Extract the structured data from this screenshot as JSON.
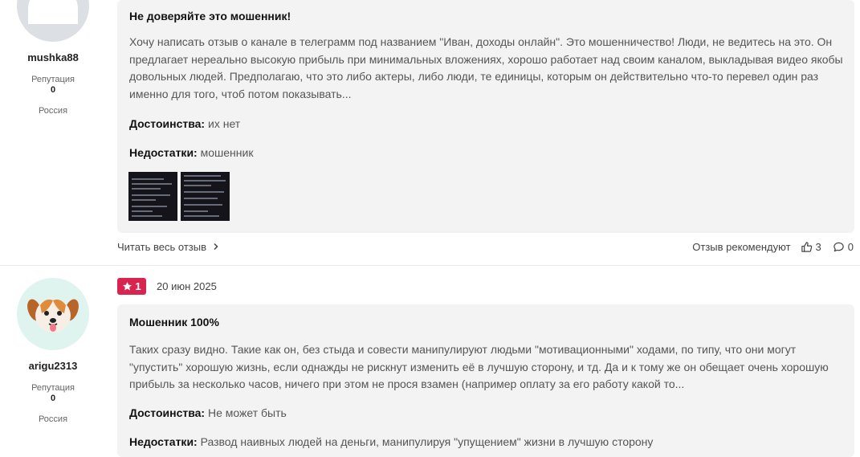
{
  "reviews": [
    {
      "user": {
        "name": "mushka88",
        "reputation_label": "Репутация",
        "reputation": "0",
        "country": "Россия"
      },
      "title": "Не доверяйте это мошенник!",
      "text": "Хочу написать отзыв о канале в телеграмм под названием \"Иван, доходы онлайн\". Это мошенничество! Люди, не ведитесь на это. Он предлагает нереально высокую прибыль при минимальных вложениях, хорошо работает над своим каналом, выкладывая видео якобы довольных людей. Предполагаю, что это либо актеры, либо люди, те единицы, которым он действительно что-то перевел один раз именно для того, чтоб потом показывать...",
      "pros_label": "Достоинства:",
      "pros": "их нет",
      "cons_label": "Недостатки:",
      "cons": "мошенник",
      "read_more": "Читать весь отзыв",
      "recommend_label": "Отзыв рекомендуют",
      "likes": "3",
      "comments": "0"
    },
    {
      "user": {
        "name": "arigu2313",
        "reputation_label": "Репутация",
        "reputation": "0",
        "country": "Россия"
      },
      "rating": "1",
      "date": "20 июн 2025",
      "title": "Мошенник 100%",
      "text": "Таких сразу видно. Такие как он, без стыда и совести манипулируют людьми \"мотивационными\" ходами, по типу, что они могут \"упустить\" хорошую жизнь, если однажды не рискнут изменить её в лучшую сторону, и тд. Да и к тому же он обещает очень хорошую прибыль за несколько часов, ничего при этом не прося взамен (например оплату за его работу какой то...",
      "pros_label": "Достоинства:",
      "pros": "Не может быть",
      "cons_label": "Недостатки:",
      "cons": "Развод наивных людей на деньги, манипулируя \"упущением\" жизни в лучшую сторону"
    }
  ],
  "colors": {
    "rating_badge": "#d8254f",
    "card_bg": "#f3f3f4"
  },
  "icons": {
    "thumb_up": "thumbs-up-icon",
    "comment": "comment-icon",
    "star": "star-icon",
    "chevron": "chevron-right-icon",
    "avatar_default": "default-avatar-icon",
    "avatar_dog": "dog-avatar-icon"
  }
}
